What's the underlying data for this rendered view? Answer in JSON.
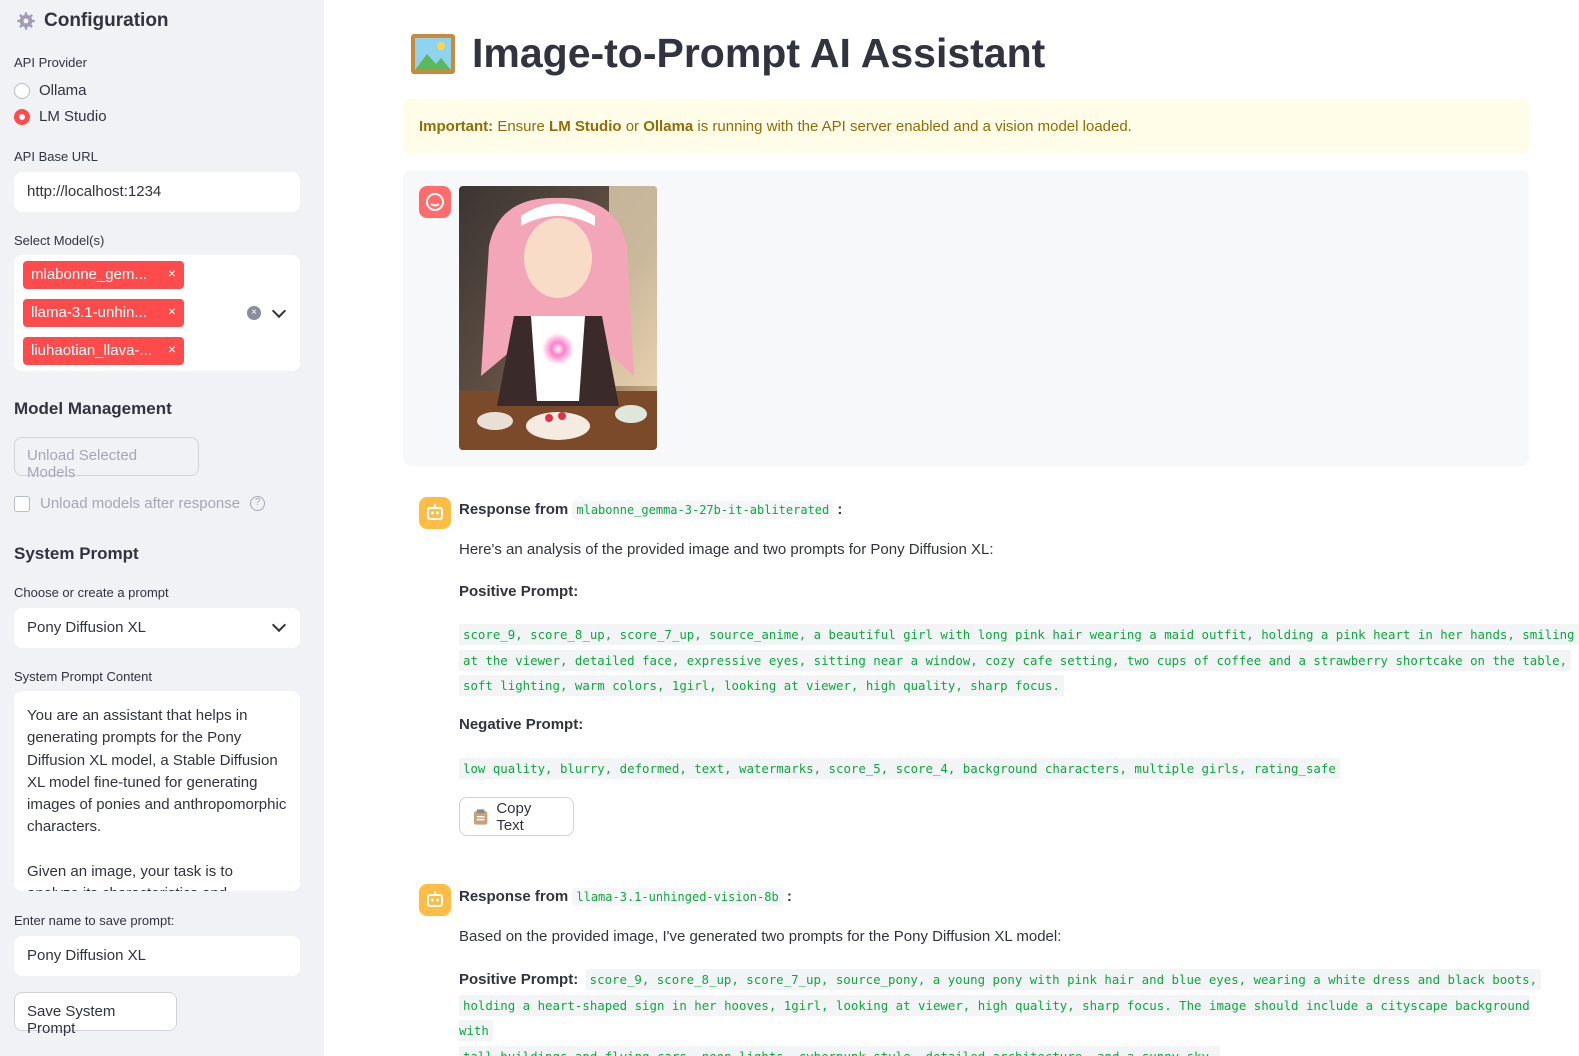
{
  "sidebar": {
    "title": "Configuration",
    "api_provider_label": "API Provider",
    "providers": [
      {
        "label": "Ollama",
        "selected": false
      },
      {
        "label": "LM Studio",
        "selected": true
      }
    ],
    "api_base_url_label": "API Base URL",
    "api_base_url_value": "http://localhost:1234",
    "select_models_label": "Select Model(s)",
    "selected_models": [
      "mlabonne_gem...",
      "llama-3.1-unhin...",
      "liuhaotian_llava-..."
    ],
    "tag_remove": "×",
    "clear_symbol": "×",
    "model_management_heading": "Model Management",
    "unload_button": "Unload Selected Models",
    "unload_checkbox_label": "Unload models after response",
    "help_symbol": "?",
    "system_prompt_heading": "System Prompt",
    "choose_prompt_label": "Choose or create a prompt",
    "choose_prompt_value": "Pony Diffusion XL",
    "system_prompt_content_label": "System Prompt Content",
    "system_prompt_content": "You are an assistant that helps in generating prompts for the Pony Diffusion XL model, a Stable Diffusion XL model fine-tuned for generating images of ponies and anthropomorphic characters.\n\nGiven an image, your task is to analyze its characteristics and generate positive",
    "save_name_label": "Enter name to save prompt:",
    "save_name_value": "Pony Diffusion XL",
    "save_button": "Save System Prompt"
  },
  "main": {
    "title": "Image-to-Prompt AI Assistant",
    "alert": {
      "important": "Important:",
      "text1": " Ensure ",
      "lm": "LM Studio",
      "text2": " or ",
      "ollama": "Ollama",
      "text3": " is running with the API server enabled and a vision model loaded."
    },
    "responses": [
      {
        "response_from": "Response from",
        "model": "mlabonne_gemma-3-27b-it-abliterated",
        "colon": ":",
        "intro": "Here's an analysis of the provided image and two prompts for Pony Diffusion XL:",
        "positive_label": "Positive Prompt:",
        "positive_lines": [
          "score_9, score_8_up, score_7_up, source_anime, a beautiful girl with long pink hair wearing a maid outfit, holding a pink heart in her hands, smiling",
          "at the viewer, detailed face, expressive eyes, sitting near a window, cozy cafe setting, two cups of coffee and a strawberry shortcake on the table,",
          "soft lighting, warm colors, 1girl, looking at viewer, high quality, sharp focus."
        ],
        "negative_label": "Negative Prompt:",
        "negative": "low quality, blurry, deformed, text, watermarks, score_5, score_4, background characters, multiple girls, rating_safe",
        "copy_button": "Copy Text"
      },
      {
        "response_from": "Response from",
        "model": "llama-3.1-unhinged-vision-8b",
        "colon": ":",
        "intro": "Based on the provided image, I've generated two prompts for the Pony Diffusion XL model:",
        "positive_label": "Positive Prompt:",
        "positive_lines": [
          "score_9, score_8_up, score_7_up, source_pony, a young pony with pink hair and blue eyes, wearing a white dress and black boots,",
          "holding a heart-shaped sign in her hooves, 1girl, looking at viewer, high quality, sharp focus. The image should include a cityscape background with",
          "tall buildings and flying cars, neon lights, cyberpunk style, detailed architecture, and a sunny sky."
        ]
      }
    ]
  },
  "colors": {
    "accent": "#ff4b4b",
    "sidebar_bg": "#f0f2f6",
    "code_green": "#09ab3b",
    "alert_bg": "#fffce7",
    "alert_text": "#926c05"
  }
}
